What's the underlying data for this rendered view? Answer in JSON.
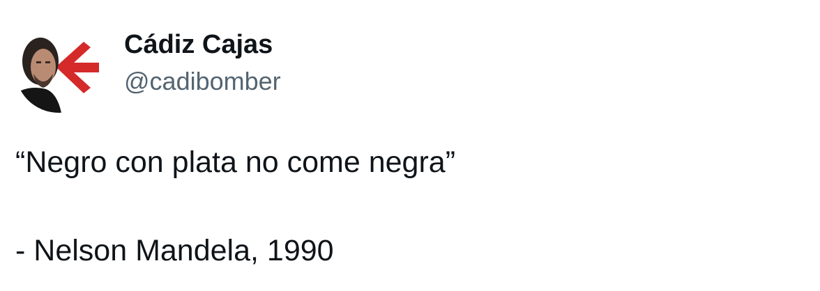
{
  "author": {
    "display_name": "Cádiz Cajas",
    "handle": "@cadibomber",
    "avatar_icon": "profile-avatar-icon"
  },
  "tweet": {
    "lines": [
      "“Negro con plata no come negra”",
      "- Nelson Mandela, 1990"
    ]
  },
  "colors": {
    "text_primary": "#0f1419",
    "text_secondary": "#536471",
    "avatar_accent": "#d42a2a"
  }
}
